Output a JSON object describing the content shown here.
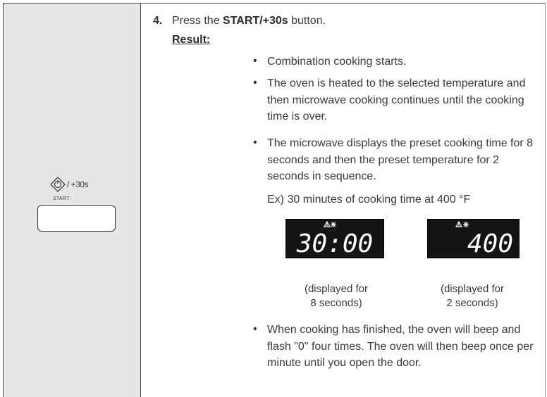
{
  "left_panel": {
    "start_symbol_caption": "/ +30s",
    "start_label": "START"
  },
  "step": {
    "number": "4.",
    "text_prefix": "Press the ",
    "button_name": "START/+30s",
    "text_suffix": " button.",
    "result_label": "Result:"
  },
  "results": [
    "Combination cooking starts.",
    "The oven is heated to the selected temperature and then microwave cooking continues until the cooking time is over.",
    "The microwave displays the preset cooking time for 8 seconds and then the preset temperature for 2 seconds in sequence.",
    "When cooking has finished, the oven will beep and flash \"0\" four times. The oven will then beep once per minute until you open the door."
  ],
  "example_text": "Ex) 30 minutes of cooking time at 400 °F",
  "displays": [
    {
      "value": "30:00",
      "caption_line1": "(displayed for",
      "caption_line2": "8 seconds)"
    },
    {
      "value": "400",
      "caption_line1": "(displayed for",
      "caption_line2": "2 seconds)"
    }
  ]
}
